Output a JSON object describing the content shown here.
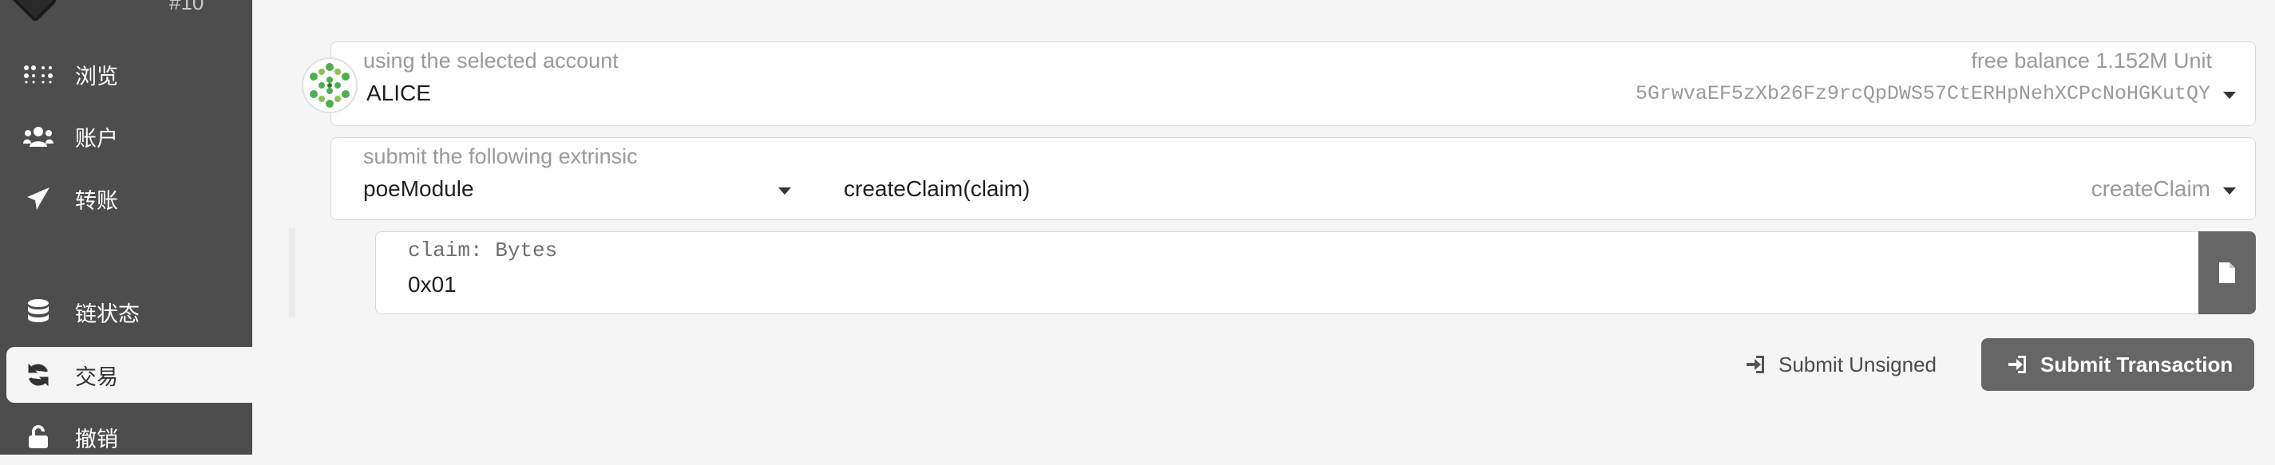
{
  "sidebar": {
    "block_number": "#10",
    "items": [
      {
        "label": "浏览",
        "icon": "grid-dots-icon"
      },
      {
        "label": "账户",
        "icon": "users-icon"
      },
      {
        "label": "转账",
        "icon": "paper-plane-icon"
      },
      {
        "label": "链状态",
        "icon": "database-icon"
      },
      {
        "label": "交易",
        "icon": "sync-icon",
        "active": true
      },
      {
        "label": "撤销",
        "icon": "unlock-icon"
      }
    ]
  },
  "account": {
    "label": "using the selected account",
    "name": "ALICE",
    "balance_label": "free balance 1.152M Unit",
    "address": "5GrwvaEF5zXb26Fz9rcQpDWS57CtERHpNehXCPcNoHGKutQY"
  },
  "extrinsic": {
    "label": "submit the following extrinsic",
    "module": "poeModule",
    "call": "createClaim(claim)",
    "method": "createClaim"
  },
  "param": {
    "label": "claim: Bytes",
    "value": "0x01"
  },
  "actions": {
    "unsigned": "Submit Unsigned",
    "submit": "Submit Transaction"
  },
  "colors": {
    "sidebar_bg": "#4d4d4d",
    "button_bg": "#666666",
    "identicon_green": "#4caf50"
  }
}
